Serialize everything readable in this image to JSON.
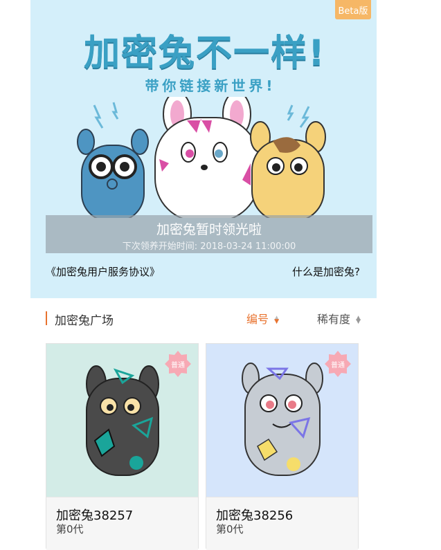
{
  "hero": {
    "beta_label": "Beta版",
    "headline": "加密兔不一样!",
    "subline": "带你链接新世界!",
    "banner_title": "加密兔暂时领光啦",
    "banner_subtitle": "下次领养开始时间: 2018-03-24 11:00:00",
    "agreement_link": "《加密兔用户服务协议》",
    "what_is_link": "什么是加密兔?"
  },
  "plaza": {
    "title": "加密兔广场",
    "sort_number": "编号",
    "sort_rarity": "稀有度"
  },
  "cards": [
    {
      "name": "加密兔38257",
      "generation": "第0代",
      "badge": "普通",
      "background": "#d3ece7",
      "body_color": "#4a4a4a"
    },
    {
      "name": "加密兔38256",
      "generation": "第0代",
      "badge": "普通",
      "background": "#d5e5fb",
      "body_color": "#c6ccd3"
    }
  ],
  "colors": {
    "accent": "#e8722e",
    "hero_bg": "#d4effa",
    "beta": "#f6b766"
  }
}
